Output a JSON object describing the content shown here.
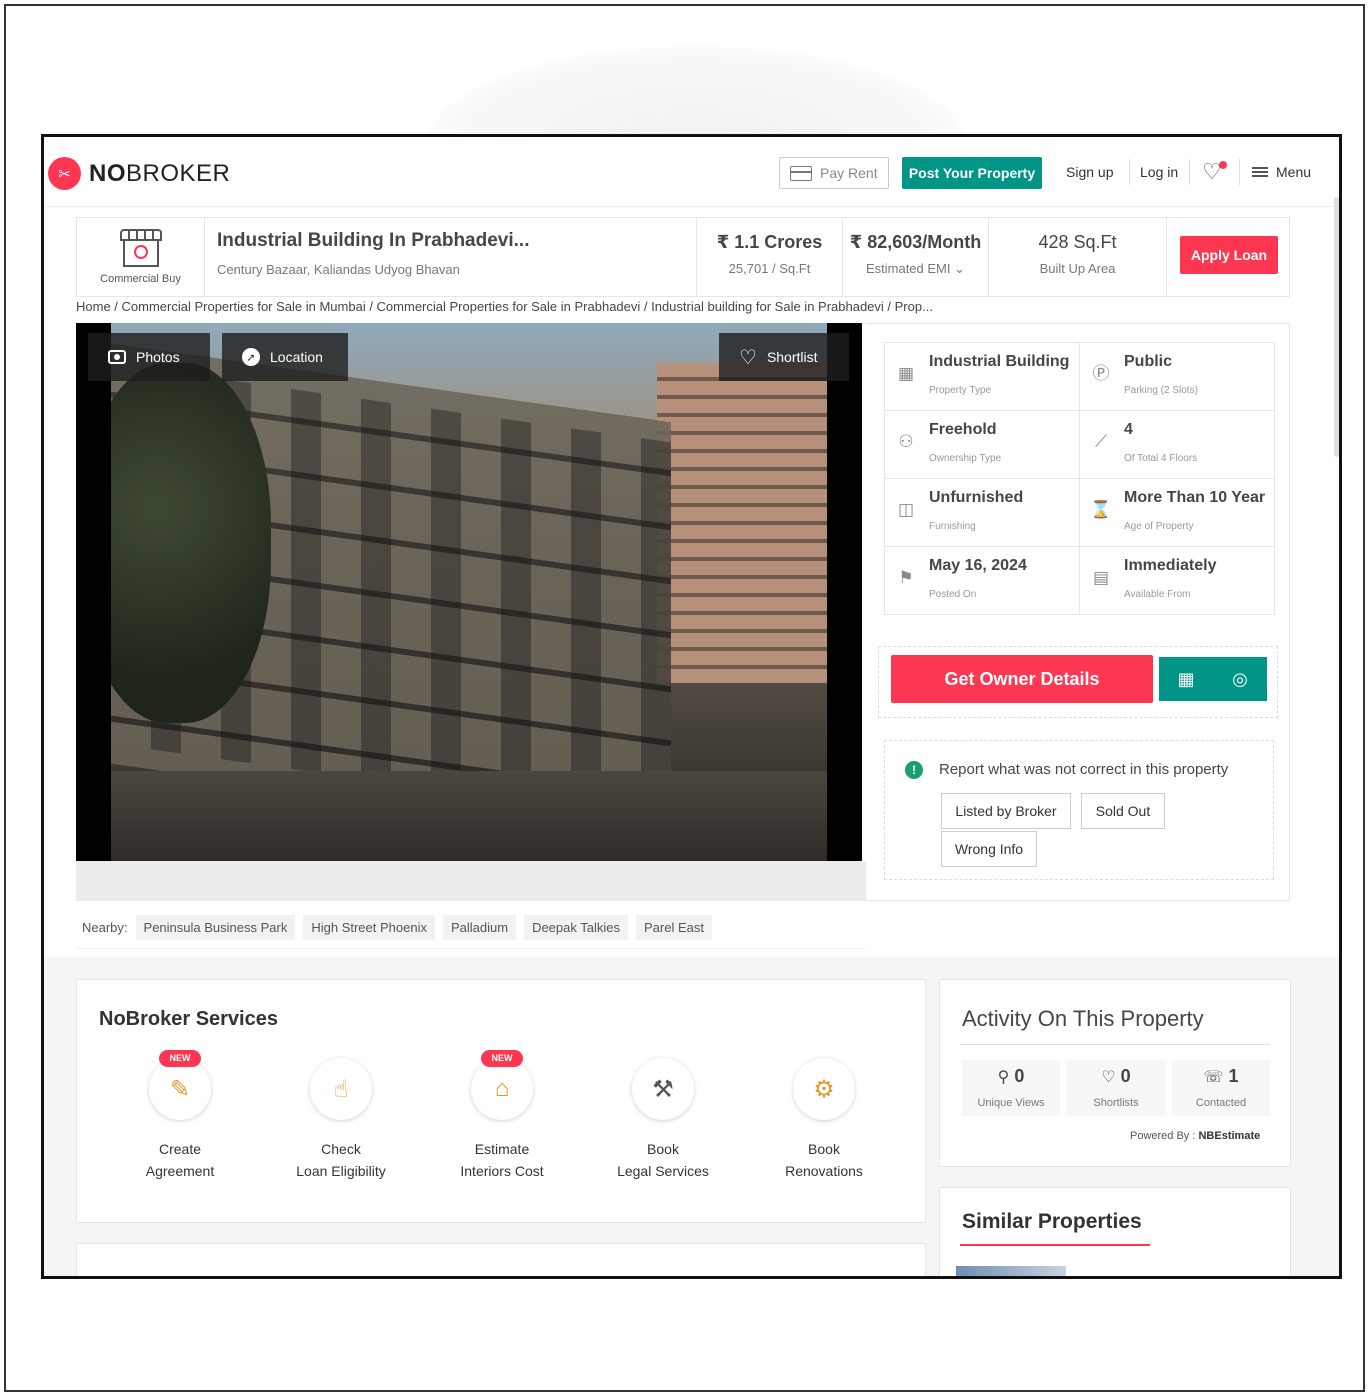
{
  "header": {
    "logo_text_bold": "NO",
    "logo_text_rest": "BROKER",
    "pay_rent": "Pay Rent",
    "post_property": "Post Your Property",
    "signup": "Sign up",
    "login": "Log in",
    "menu": "Menu"
  },
  "summary": {
    "category_label": "Commercial Buy",
    "title": "Industrial Building In Prabhadevi...",
    "address": "Century Bazaar, Kaliandas Udyog Bhavan",
    "price": "₹ 1.1 Crores",
    "price_per_sqft": "25,701 / Sq.Ft",
    "emi": "₹ 82,603/Month",
    "emi_label": "Estimated EMI",
    "area": "428 Sq.Ft",
    "area_label": "Built Up Area",
    "apply_loan": "Apply Loan"
  },
  "breadcrumb": "Home / Commercial Properties for Sale in Mumbai / Commercial Properties for Sale in Prabhadevi / Industrial building for Sale in Prabhadevi / Prop...",
  "gallery": {
    "photos": "Photos",
    "location": "Location",
    "shortlist": "Shortlist"
  },
  "nearby": {
    "label": "Nearby:",
    "items": [
      "Peninsula Business Park",
      "High Street Phoenix",
      "Palladium",
      "Deepak Talkies",
      "Parel East"
    ]
  },
  "details": [
    {
      "value": "Industrial Building",
      "label": "Property Type",
      "icon": "building-icon"
    },
    {
      "value": "Public",
      "label": "Parking  (2 Slots)",
      "icon": "parking-icon"
    },
    {
      "value": "Freehold",
      "label": "Ownership Type",
      "icon": "owner-icon"
    },
    {
      "value": "4",
      "label": "Of Total 4 Floors",
      "icon": "stairs-icon"
    },
    {
      "value": "Unfurnished",
      "label": "Furnishing",
      "icon": "furnishing-icon"
    },
    {
      "value": "More Than 10 Year",
      "label": "Age of Property",
      "icon": "hourglass-icon"
    },
    {
      "value": "May 16, 2024",
      "label": "Posted On",
      "icon": "flag-icon"
    },
    {
      "value": "Immediately",
      "label": "Available From",
      "icon": "calendar-icon"
    }
  ],
  "cta": {
    "owner_details": "Get Owner Details"
  },
  "report": {
    "text": "Report what was not correct in this property",
    "options": [
      "Listed by Broker",
      "Sold Out",
      "Wrong Info"
    ]
  },
  "services": {
    "title": "NoBroker Services",
    "new_badge": "NEW",
    "items": [
      {
        "line1": "Create",
        "line2": "Agreement",
        "icon": "agreement-icon",
        "new": true
      },
      {
        "line1": "Check",
        "line2": "Loan Eligibility",
        "icon": "loan-icon",
        "new": false
      },
      {
        "line1": "Estimate",
        "line2": "Interiors Cost",
        "icon": "interiors-icon",
        "new": true
      },
      {
        "line1": "Book",
        "line2": "Legal Services",
        "icon": "gavel-icon",
        "new": false
      },
      {
        "line1": "Book",
        "line2": "Renovations",
        "icon": "renovation-icon",
        "new": false
      }
    ]
  },
  "activity": {
    "title": "Activity On This Property",
    "stats": [
      {
        "value": "0",
        "label": "Unique Views",
        "icon": "user-icon"
      },
      {
        "value": "0",
        "label": "Shortlists",
        "icon": "heart-icon"
      },
      {
        "value": "1",
        "label": "Contacted",
        "icon": "phone-icon"
      }
    ],
    "powered_label": "Powered By :",
    "powered_by": "NBEstimate"
  },
  "similar": {
    "title": "Similar Properties"
  },
  "colors": {
    "brand_red": "#fd3752",
    "brand_teal": "#009587"
  }
}
